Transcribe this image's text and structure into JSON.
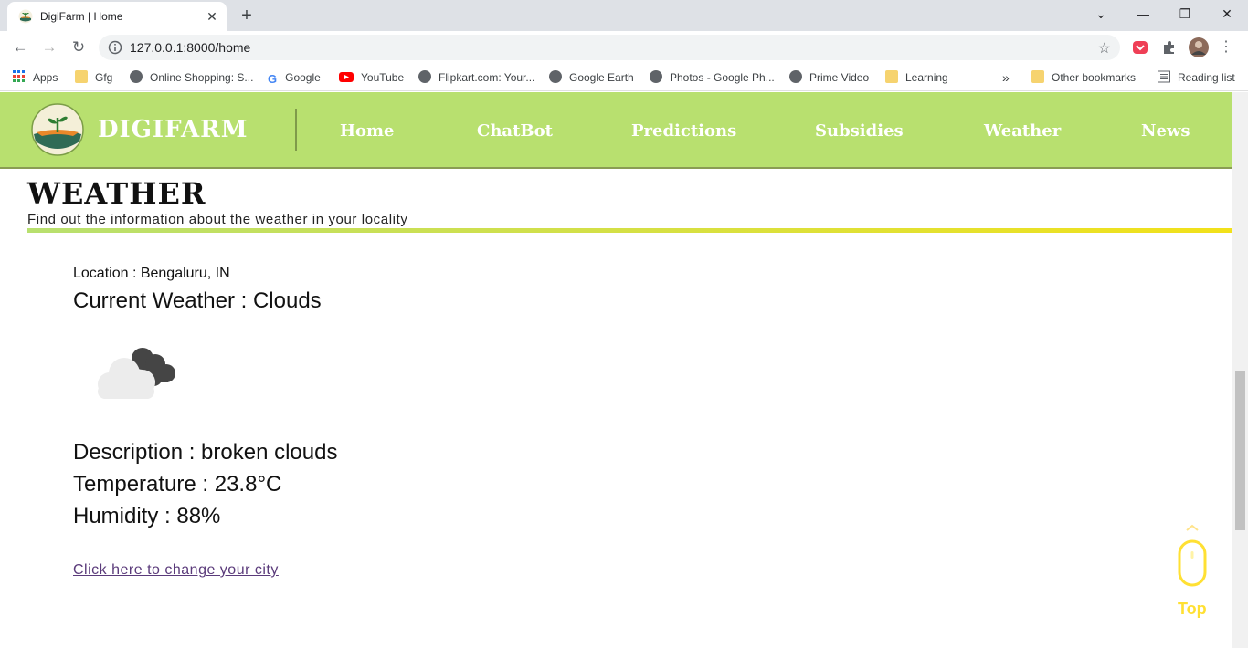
{
  "browser": {
    "tab_title": "DigiFarm | Home",
    "url": "127.0.0.1:8000/home",
    "bookmarks": [
      {
        "label": "Apps",
        "icon": "apps-grid-icon"
      },
      {
        "label": "Gfg",
        "icon": "folder-icon"
      },
      {
        "label": "Online Shopping: S...",
        "icon": "globe-icon"
      },
      {
        "label": "Google",
        "icon": "google-icon"
      },
      {
        "label": "YouTube",
        "icon": "youtube-icon"
      },
      {
        "label": "Flipkart.com: Your...",
        "icon": "globe-icon"
      },
      {
        "label": "Google Earth",
        "icon": "globe-icon"
      },
      {
        "label": "Photos - Google Ph...",
        "icon": "globe-icon"
      },
      {
        "label": "Prime Video",
        "icon": "globe-icon"
      },
      {
        "label": "Learning",
        "icon": "folder-icon"
      },
      {
        "label": "Other bookmarks",
        "icon": "folder-icon"
      },
      {
        "label": "Reading list",
        "icon": "reading-list-icon"
      }
    ],
    "more_bookmarks": "»"
  },
  "header": {
    "brand": "DIGIFARM",
    "nav": [
      "Home",
      "ChatBot",
      "Predictions",
      "Subsidies",
      "Weather",
      "News"
    ]
  },
  "main": {
    "title": "WEATHER",
    "subtitle": "Find out the information about the weather in your locality",
    "location": "Location : Bengaluru, IN",
    "current_weather": "Current Weather : Clouds",
    "weather_icon": "broken-clouds-icon",
    "description": "Description : broken clouds",
    "temperature": "Temperature : 23.8°C",
    "humidity": "Humidity : 88%",
    "change_city_link": "Click here to change your city"
  },
  "back_to_top": {
    "label": "Top"
  },
  "colors": {
    "header_bg": "#b8e06f",
    "accent_yellow": "#f2e11a",
    "top_button": "#ffe033",
    "link": "#5a3a7a"
  }
}
